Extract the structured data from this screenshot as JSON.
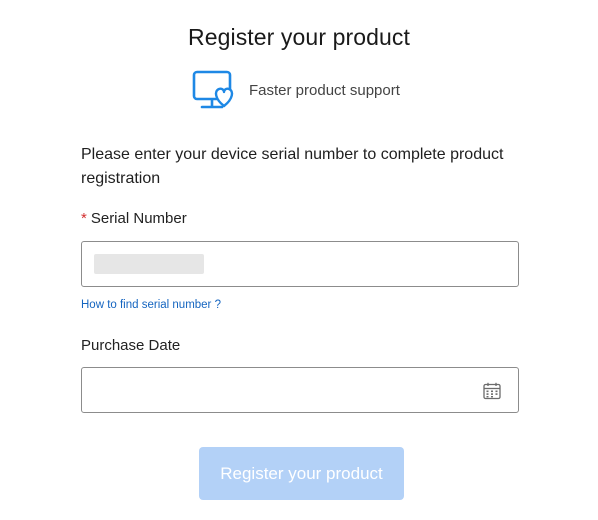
{
  "page": {
    "title": "Register your product",
    "feature_text": "Faster product support",
    "instruction": "Please enter your device serial number to complete product registration"
  },
  "form": {
    "serial_required_mark": "*",
    "serial_label": "Serial Number",
    "serial_value": "",
    "help_link": "How to find serial number ?",
    "date_label": "Purchase Date",
    "date_value": "",
    "submit_label": "Register your product"
  },
  "icons": {
    "feature": "monitor-heart-icon",
    "calendar": "calendar-icon"
  },
  "colors": {
    "accent": "#1e88e5",
    "link": "#1565c0",
    "required": "#d32f2f",
    "submit_disabled": "#b3d1f7"
  }
}
